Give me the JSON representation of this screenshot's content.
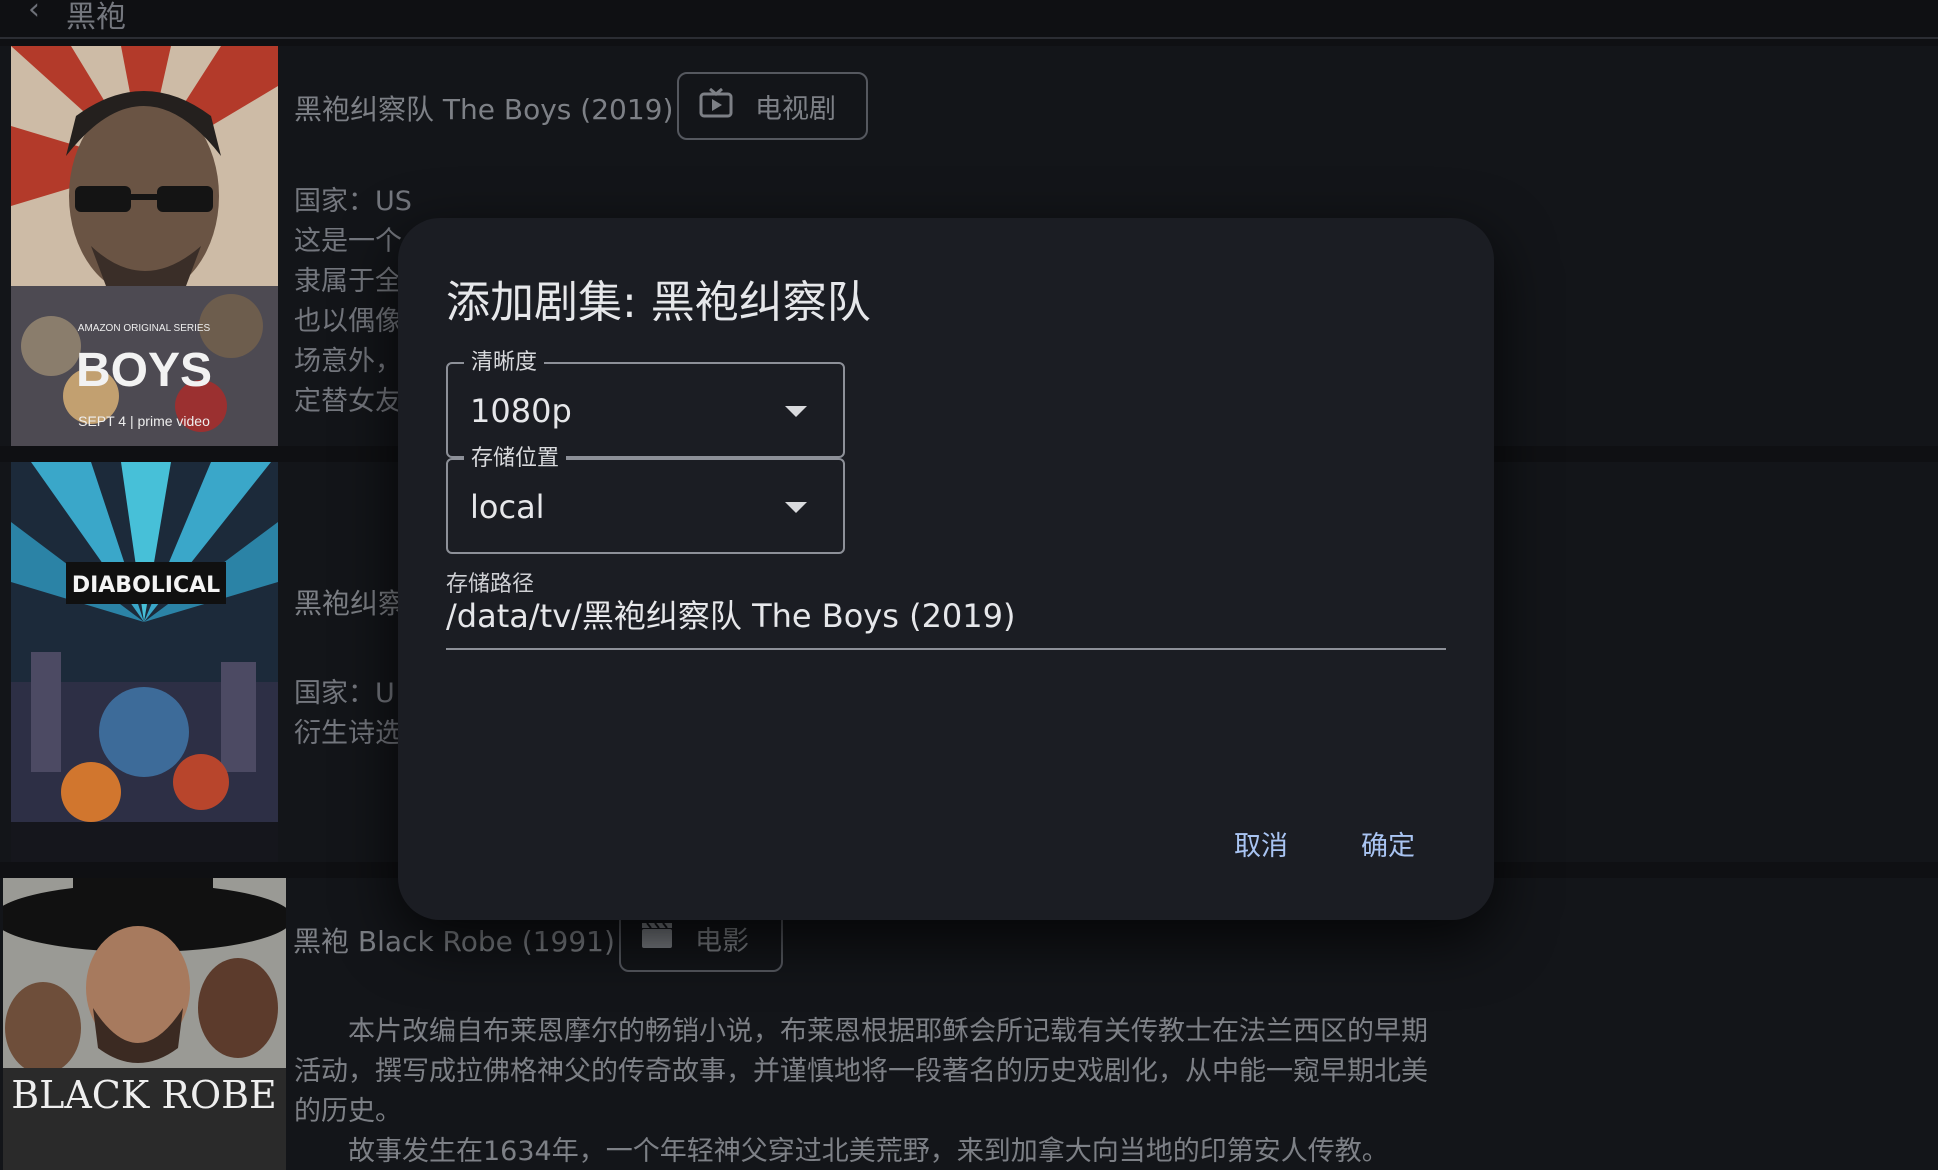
{
  "header": {
    "title": "黑袍",
    "back_icon": "chevron-left-icon"
  },
  "results": [
    {
      "title": "黑袍纠察队 The Boys (2019)",
      "type_label": "电视剧",
      "type_icon": "tv-icon",
      "meta_lines": [
        "国家：US",
        "这是一个",
        "隶属于全",
        "也以偶像",
        "场意外，",
        "定替女友"
      ]
    },
    {
      "title": "黑袍纠察",
      "meta_lines": [
        "国家：U",
        "衍生诗选"
      ]
    },
    {
      "title": "黑袍 Black Robe (1991)",
      "type_label": "电影",
      "type_icon": "clapperboard-icon",
      "description": [
        "本片改编自布莱恩摩尔的畅销小说，布莱恩根据耶稣会所记载有关传教士在法兰西区的早期活动，撰写成拉佛格神父的传奇故事，并谨慎地将一段著名的历史戏剧化，从中能一窥早期北美的历史。",
        "故事发生在1634年，一个年轻神父穿过北美荒野，来到加拿大向当地的印第安人传教。"
      ],
      "poster_text": "BLACK ROBE"
    }
  ],
  "dialog": {
    "title": "添加剧集: 黑袍纠察队",
    "quality": {
      "label": "清晰度",
      "value": "1080p"
    },
    "storage": {
      "label": "存储位置",
      "value": "local"
    },
    "path": {
      "label": "存储路径",
      "value": "/data/tv/黑袍纠察队 The Boys (2019)"
    },
    "cancel_label": "取消",
    "confirm_label": "确定"
  },
  "colors": {
    "accent": "#a9c4f2",
    "dialog_bg": "#1b1d23",
    "page_bg": "#0f1013"
  }
}
